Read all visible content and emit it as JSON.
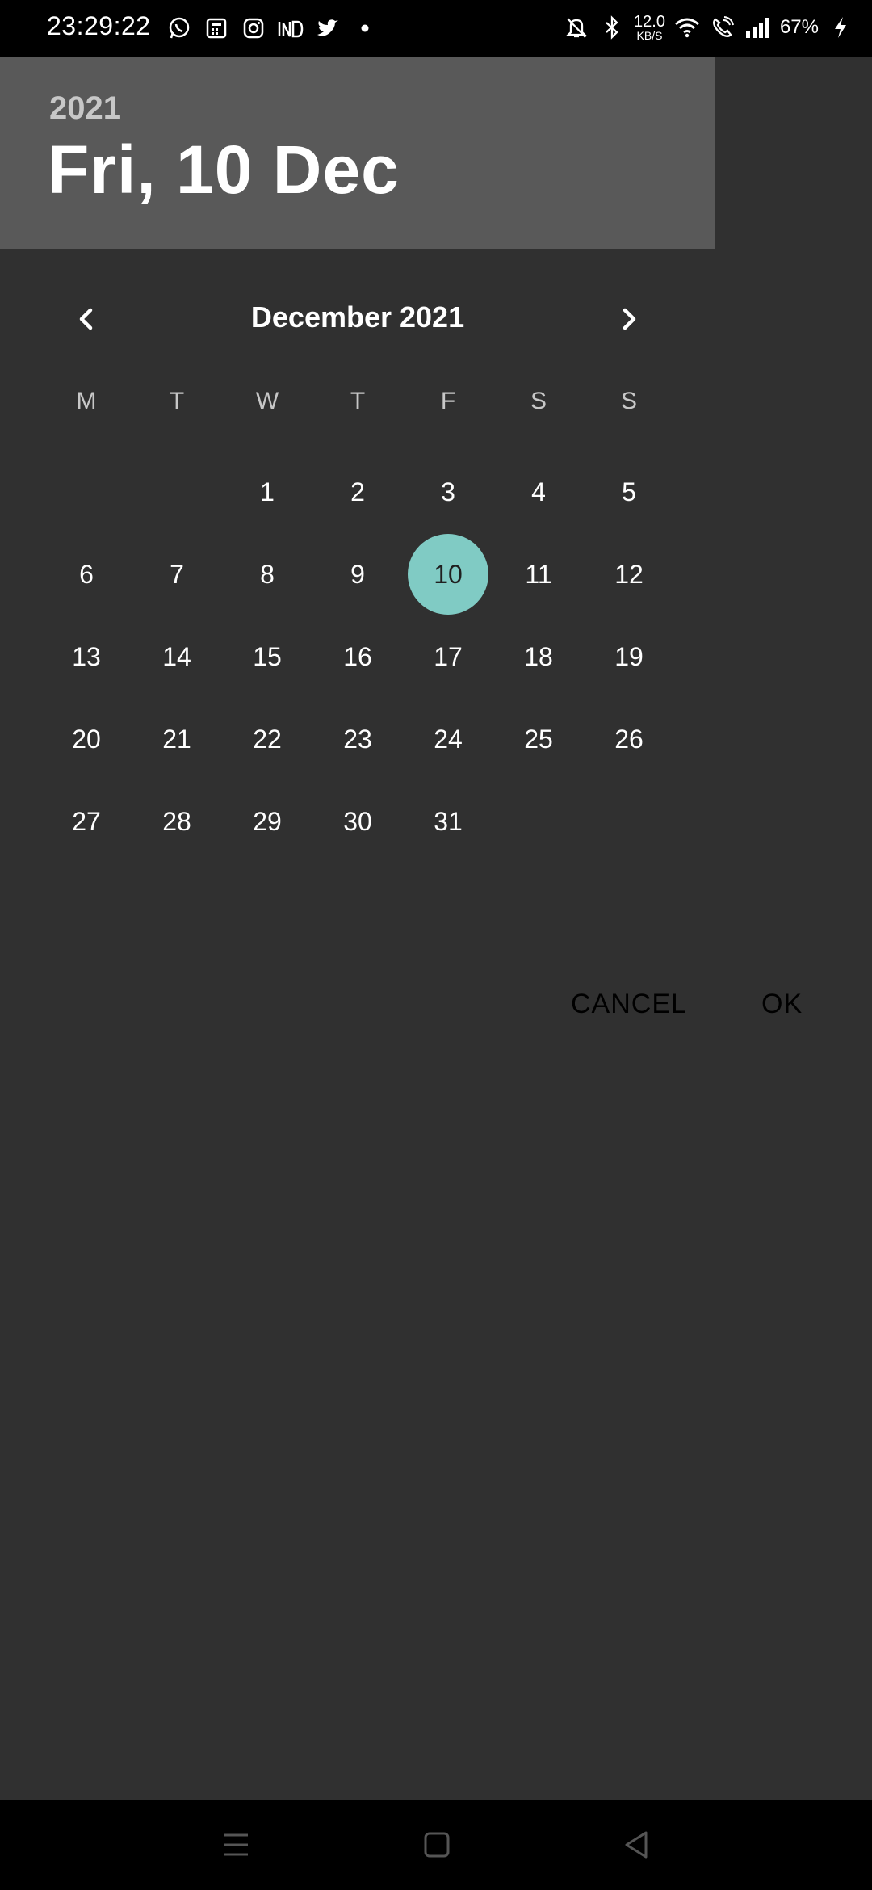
{
  "status_bar": {
    "time": "23:29:22",
    "left_icons": [
      "whatsapp-icon",
      "calculator-icon",
      "instagram-icon",
      "ind-icon",
      "twitter-icon",
      "dot-icon"
    ],
    "network_speed_value": "12.0",
    "network_speed_unit": "KB/S",
    "battery": "67%",
    "right_icons": [
      "mute-icon",
      "bluetooth-icon",
      "wifi-icon",
      "wifi-call-icon",
      "signal-icon",
      "charging-icon"
    ]
  },
  "header": {
    "year": "2021",
    "date": "Fri, 10 Dec"
  },
  "calendar": {
    "month_title": "December 2021",
    "weekdays": [
      "M",
      "T",
      "W",
      "T",
      "F",
      "S",
      "S"
    ],
    "weeks": [
      [
        "",
        "",
        "1",
        "2",
        "3",
        "4",
        "5"
      ],
      [
        "6",
        "7",
        "8",
        "9",
        "10",
        "11",
        "12"
      ],
      [
        "13",
        "14",
        "15",
        "16",
        "17",
        "18",
        "19"
      ],
      [
        "20",
        "21",
        "22",
        "23",
        "24",
        "25",
        "26"
      ],
      [
        "27",
        "28",
        "29",
        "30",
        "31",
        "",
        ""
      ]
    ],
    "selected_day": "10",
    "accent_color": "#80cbc4"
  },
  "actions": {
    "cancel": "CANCEL",
    "ok": "OK"
  },
  "navigation_bar": {
    "icons": [
      "menu-icon",
      "home-icon",
      "back-icon"
    ]
  }
}
